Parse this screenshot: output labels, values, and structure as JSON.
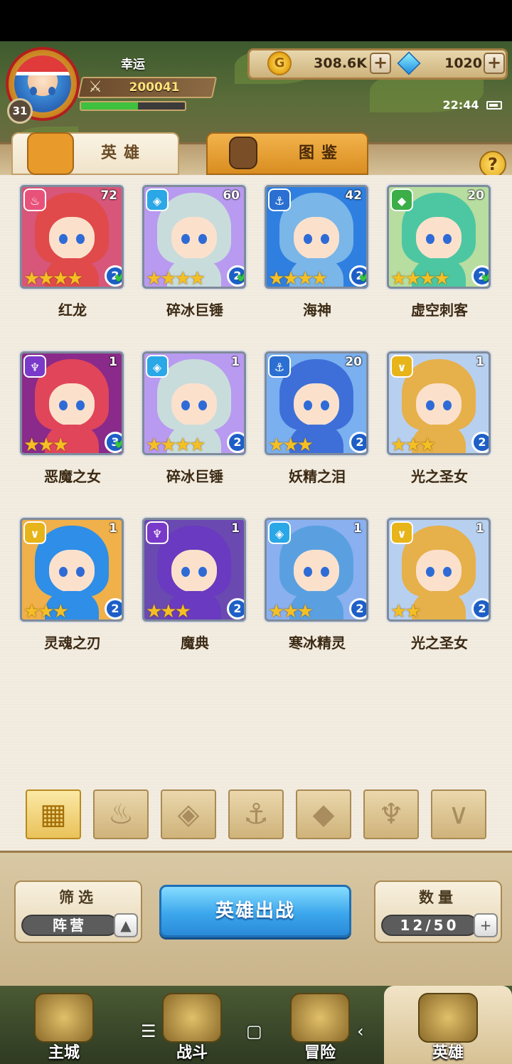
{
  "player": {
    "name": "幸运",
    "level": "31",
    "power": "200041",
    "exp_fraction": 0.55
  },
  "currency": {
    "gold": "308.6K",
    "diamonds": "1020",
    "plus": "+"
  },
  "status": {
    "time": "22:44"
  },
  "tabs": {
    "heroes": "英雄",
    "book": "图鉴",
    "help": "?"
  },
  "heroes": [
    {
      "name": "红龙",
      "level": "72",
      "stars": "★★★★",
      "grade": "2",
      "checked": true,
      "faction": "fire",
      "color": "#e8527a"
    },
    {
      "name": "碎冰巨锤",
      "level": "60",
      "stars": "★★★★",
      "grade": "2",
      "checked": true,
      "faction": "ice",
      "color": "#2aa7e6"
    },
    {
      "name": "海神",
      "level": "42",
      "stars": "★★★★",
      "grade": "2",
      "checked": true,
      "faction": "sea",
      "color": "#2a6fd1"
    },
    {
      "name": "虚空刺客",
      "level": "20",
      "stars": "★★★★",
      "grade": "2",
      "checked": true,
      "faction": "beast",
      "color": "#3cae48"
    },
    {
      "name": "恶魔之女",
      "level": "1",
      "stars": "★★★",
      "grade": "3",
      "checked": true,
      "faction": "demon",
      "color": "#7a3ac9"
    },
    {
      "name": "碎冰巨锤",
      "level": "1",
      "stars": "★★★★",
      "grade": "2",
      "checked": false,
      "faction": "ice",
      "color": "#2aa7e6"
    },
    {
      "name": "妖精之泪",
      "level": "20",
      "stars": "★★★",
      "grade": "2",
      "checked": false,
      "faction": "sea",
      "color": "#2a6fd1"
    },
    {
      "name": "光之圣女",
      "level": "1",
      "stars": "★★★",
      "grade": "2",
      "checked": false,
      "faction": "light",
      "color": "#e7b419"
    },
    {
      "name": "灵魂之刃",
      "level": "1",
      "stars": "★★★",
      "grade": "2",
      "checked": false,
      "faction": "light",
      "color": "#e7b419"
    },
    {
      "name": "魔典",
      "level": "1",
      "stars": "★★★",
      "grade": "2",
      "checked": false,
      "faction": "demon",
      "color": "#7a3ac9"
    },
    {
      "name": "寒冰精灵",
      "level": "1",
      "stars": "★★★",
      "grade": "2",
      "checked": false,
      "faction": "ice",
      "color": "#2aa7e6"
    },
    {
      "name": "光之圣女",
      "level": "1",
      "stars": "★★",
      "grade": "2",
      "checked": false,
      "faction": "light",
      "color": "#e7b419"
    }
  ],
  "filters": [
    "all-icon",
    "fire-icon",
    "ice-icon",
    "anchor-icon",
    "beast-icon",
    "demon-icon",
    "light-icon"
  ],
  "bottom": {
    "filter_title": "筛选",
    "filter_value": "阵营",
    "deploy": "英雄出战",
    "count_title": "数量",
    "count_value": "12/50"
  },
  "nav": [
    {
      "label": "主城",
      "active": false
    },
    {
      "label": "战斗",
      "active": false
    },
    {
      "label": "冒险",
      "active": false
    },
    {
      "label": "英雄",
      "active": true
    }
  ]
}
